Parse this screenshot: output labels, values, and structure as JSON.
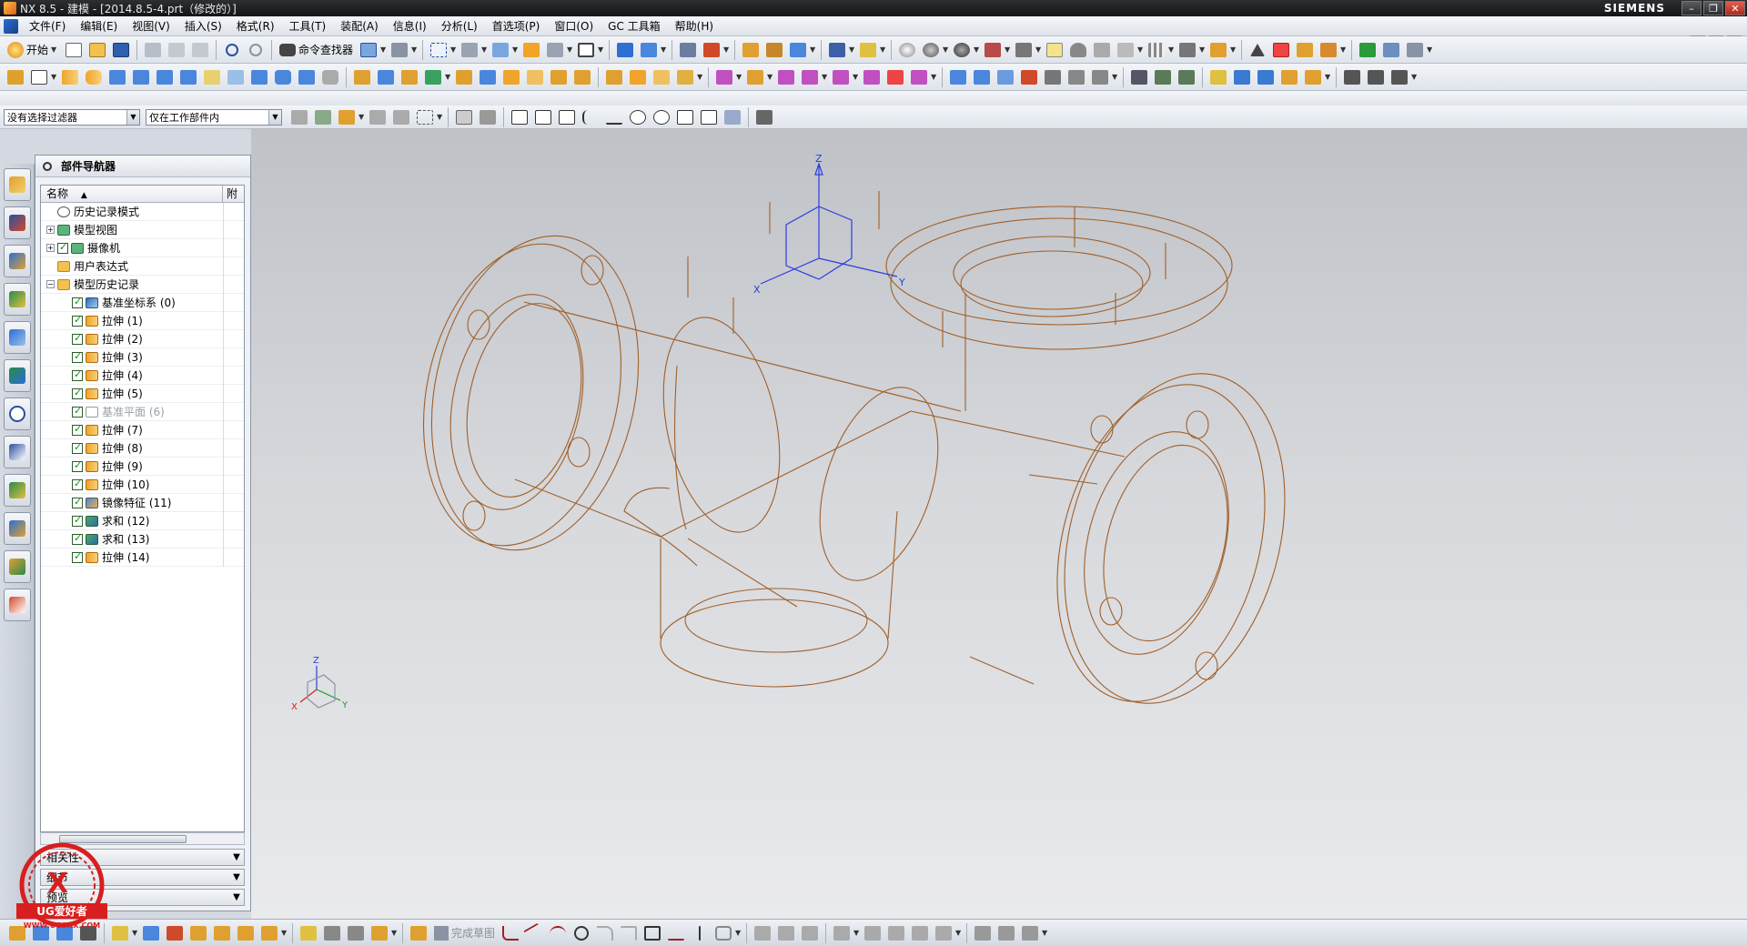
{
  "window": {
    "title": "NX 8.5 - 建模 - [2014.8.5-4.prt（修改的）]",
    "brand": "SIEMENS"
  },
  "menu": [
    "文件(F)",
    "编辑(E)",
    "视图(V)",
    "插入(S)",
    "格式(R)",
    "工具(T)",
    "装配(A)",
    "信息(I)",
    "分析(L)",
    "首选项(P)",
    "窗口(O)",
    "GC 工具箱",
    "帮助(H)"
  ],
  "toolbar": {
    "start_label": "开始",
    "finder_label": "命令查找器",
    "finish_sketch": "完成草图"
  },
  "selection": {
    "filter": "没有选择过滤器",
    "scope": "仅在工作部件内"
  },
  "navigator": {
    "title": "部件导航器",
    "col_name": "名称",
    "col_attach": "附",
    "items": [
      {
        "label": "历史记录模式",
        "icon": "clock",
        "indent": 1,
        "expander": "",
        "check": false,
        "dim": false
      },
      {
        "label": "模型视图",
        "icon": "view",
        "indent": 0,
        "expander": "+",
        "check": false,
        "dim": false
      },
      {
        "label": "摄像机",
        "icon": "camera",
        "indent": 0,
        "expander": "+",
        "check": true,
        "dim": false
      },
      {
        "label": "用户表达式",
        "icon": "fold",
        "indent": 1,
        "expander": "",
        "check": false,
        "dim": false
      },
      {
        "label": "模型历史记录",
        "icon": "fold",
        "indent": 0,
        "expander": "−",
        "check": false,
        "dim": false
      },
      {
        "label": "基准坐标系 (0)",
        "icon": "csys",
        "indent": 2,
        "expander": "",
        "check": true,
        "dim": false
      },
      {
        "label": "拉伸 (1)",
        "icon": "ext",
        "indent": 2,
        "expander": "",
        "check": true,
        "dim": false
      },
      {
        "label": "拉伸 (2)",
        "icon": "ext",
        "indent": 2,
        "expander": "",
        "check": true,
        "dim": false
      },
      {
        "label": "拉伸 (3)",
        "icon": "ext",
        "indent": 2,
        "expander": "",
        "check": true,
        "dim": false
      },
      {
        "label": "拉伸 (4)",
        "icon": "ext",
        "indent": 2,
        "expander": "",
        "check": true,
        "dim": false
      },
      {
        "label": "拉伸 (5)",
        "icon": "ext",
        "indent": 2,
        "expander": "",
        "check": true,
        "dim": false
      },
      {
        "label": "基准平面 (6)",
        "icon": "plane",
        "indent": 2,
        "expander": "",
        "check": true,
        "dim": true
      },
      {
        "label": "拉伸 (7)",
        "icon": "ext",
        "indent": 2,
        "expander": "",
        "check": true,
        "dim": false
      },
      {
        "label": "拉伸 (8)",
        "icon": "ext",
        "indent": 2,
        "expander": "",
        "check": true,
        "dim": false
      },
      {
        "label": "拉伸 (9)",
        "icon": "ext",
        "indent": 2,
        "expander": "",
        "check": true,
        "dim": false
      },
      {
        "label": "拉伸 (10)",
        "icon": "ext",
        "indent": 2,
        "expander": "",
        "check": true,
        "dim": false
      },
      {
        "label": "镜像特征 (11)",
        "icon": "mirror",
        "indent": 2,
        "expander": "",
        "check": true,
        "dim": false
      },
      {
        "label": "求和 (12)",
        "icon": "unite",
        "indent": 2,
        "expander": "",
        "check": true,
        "dim": false
      },
      {
        "label": "求和 (13)",
        "icon": "unite",
        "indent": 2,
        "expander": "",
        "check": true,
        "dim": false
      },
      {
        "label": "拉伸 (14)",
        "icon": "ext",
        "indent": 2,
        "expander": "",
        "check": true,
        "dim": false
      }
    ],
    "panels": [
      "相关性",
      "细节",
      "预览"
    ]
  },
  "viewport": {
    "axis_z": "Z",
    "axis_x": "X",
    "axis_y": "Y",
    "model_color": "#a0602a",
    "csys_color": "#2b3ee0"
  },
  "watermark": {
    "text": "UG爱好者",
    "url": "WWW.UGSNX.COM",
    "mark": "X"
  }
}
